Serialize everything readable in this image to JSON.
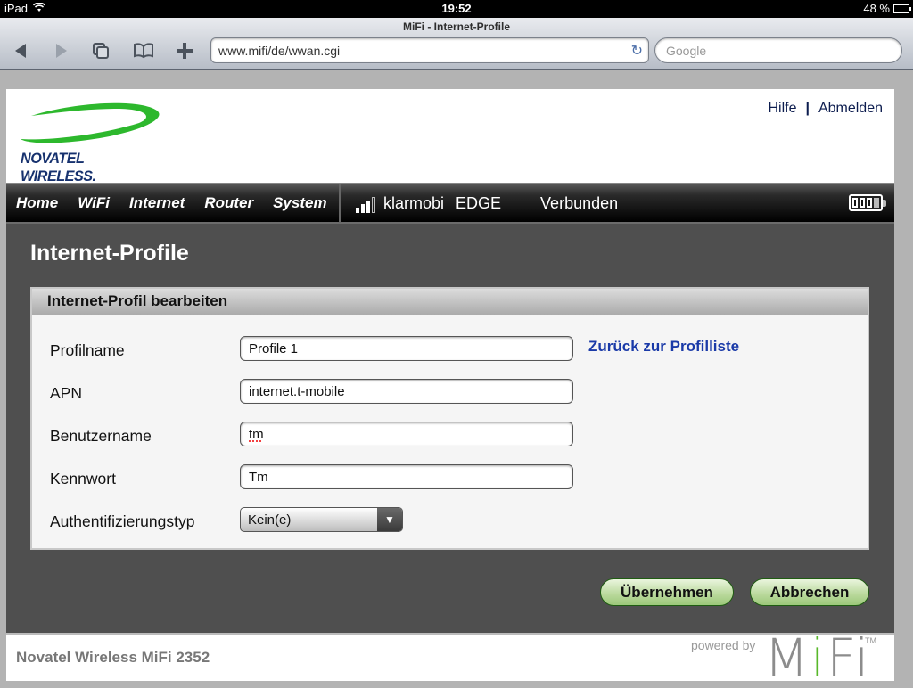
{
  "status_bar": {
    "device": "iPad",
    "time": "19:52",
    "battery_text": "48 %",
    "battery_level": 0.48
  },
  "browser": {
    "page_title": "MiFi - Internet-Profile",
    "url": "www.mifi/de/wwan.cgi",
    "search_placeholder": "Google",
    "icons": [
      "back-icon",
      "forward-icon",
      "tabs-icon",
      "bookmarks-icon",
      "add-icon",
      "reload-icon"
    ]
  },
  "header": {
    "brand": "NOVATEL WIRELESS.",
    "links": [
      "Hilfe",
      "Abmelden"
    ],
    "separator": "|"
  },
  "nav": {
    "items": [
      "Home",
      "WiFi",
      "Internet",
      "Router",
      "System"
    ],
    "signal_bars": 3,
    "signal_max": 4,
    "carrier": "klarmobi",
    "technology": "EDGE",
    "connection_status": "Verbunden",
    "battery_segments": 3,
    "battery_max": 4
  },
  "main": {
    "title": "Internet-Profile",
    "panel_title": "Internet-Profil bearbeiten",
    "back_link": "Zurück zur Profilliste",
    "fields": [
      {
        "label": "Profilname",
        "value": "Profile 1"
      },
      {
        "label": "APN",
        "value": "internet.t-mobile"
      },
      {
        "label": "Benutzername",
        "value": "tm"
      },
      {
        "label": "Kennwort",
        "value": "Tm"
      },
      {
        "label": "Authentifizierungstyp",
        "value": "Kein(e)"
      }
    ],
    "buttons": {
      "apply": "Übernehmen",
      "cancel": "Abbrechen"
    }
  },
  "footer": {
    "product": "Novatel Wireless MiFi 2352",
    "powered_by": "powered by",
    "logo": "MiFi",
    "trademark": "TM"
  },
  "colors": {
    "logo_green": "#2db82d",
    "logo_blue": "#16316e",
    "link_blue": "#1a3aa8",
    "button_green": "#b8d89a",
    "page_dark": "#4f4f4f"
  }
}
